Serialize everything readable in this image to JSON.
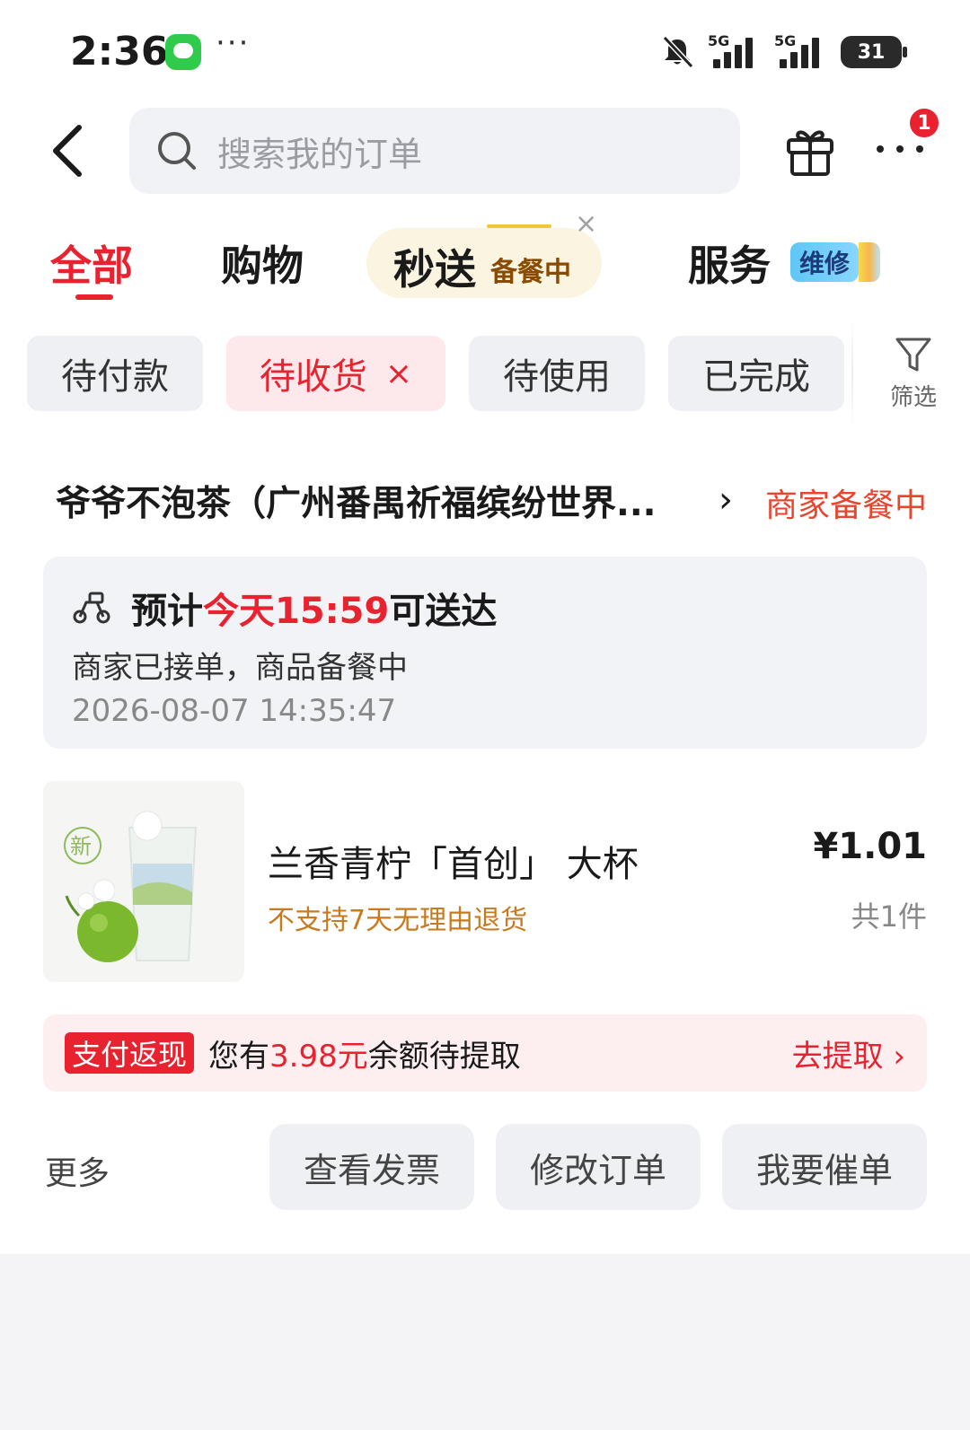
{
  "status_bar": {
    "time": "2:36",
    "more": "···",
    "signal_1": "5G",
    "signal_2": "5G",
    "battery": "31",
    "icons": [
      "message-icon",
      "bell-muted-icon",
      "signal-icon",
      "battery-icon"
    ]
  },
  "header": {
    "search_placeholder": "搜索我的订单",
    "badge_count": "1"
  },
  "tabs": [
    {
      "label": "全部",
      "active": true
    },
    {
      "label": "购物"
    },
    {
      "label": "秒送",
      "tag": "备餐中"
    },
    {
      "label": "服务",
      "tag": "维修"
    }
  ],
  "tab_close": "×",
  "filters": {
    "chips": [
      "待付款",
      "待收货",
      "待使用",
      "已完成"
    ],
    "selected": "待收货",
    "remove_glyph": "×",
    "filter_label": "筛选"
  },
  "order": {
    "store_name": "爷爷不泡茶（广州番禺祈福缤纷世界...",
    "store_arrow": "›",
    "status": "商家备餐中",
    "delivery": {
      "prefix": "预计",
      "highlight": "今天15:59",
      "suffix": "可送达",
      "message": "商家已接单，商品备餐中",
      "timestamp": "2026-08-07 14:35:47"
    },
    "product": {
      "name": "兰香青柠「首创」 大杯",
      "note": "不支持7天无理由退货",
      "price": "¥1.01",
      "count": "共1件",
      "image_badge": "新"
    },
    "cashback": {
      "tag": "支付返现",
      "text_prefix": "您有",
      "amount": "3.98元",
      "text_suffix": "余额待提取",
      "action": "去提取 ›"
    },
    "actions": {
      "more": "更多",
      "buttons": [
        "查看发票",
        "修改订单",
        "我要催单"
      ]
    }
  },
  "colors": {
    "accent_red": "#e8232f",
    "warning_orange": "#c87a1e",
    "chip_bg": "#eef0f3"
  }
}
